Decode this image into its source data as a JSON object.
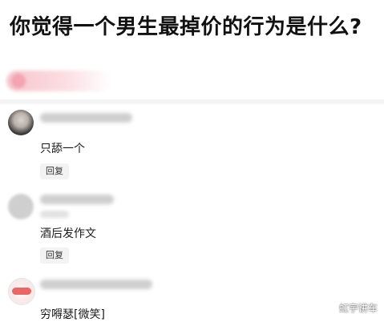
{
  "question": {
    "title": "你觉得一个男生最掉价的行为是什么?"
  },
  "comments": [
    {
      "content": "只舔一个",
      "reply_label": "回复"
    },
    {
      "content": "酒后发作文",
      "reply_label": "回复"
    },
    {
      "content": "穷嘚瑟[微笑]"
    }
  ],
  "watermark": "虹宇讲车",
  "colors": {
    "promo_pink": "#f7c4cc",
    "reply_bg": "#f3f3f3",
    "divider": "#f4f4f4"
  },
  "icons": {
    "avatar_1": "user-avatar-photo",
    "avatar_2": "user-avatar-blurred",
    "avatar_3": "brand-logo-avatar"
  }
}
